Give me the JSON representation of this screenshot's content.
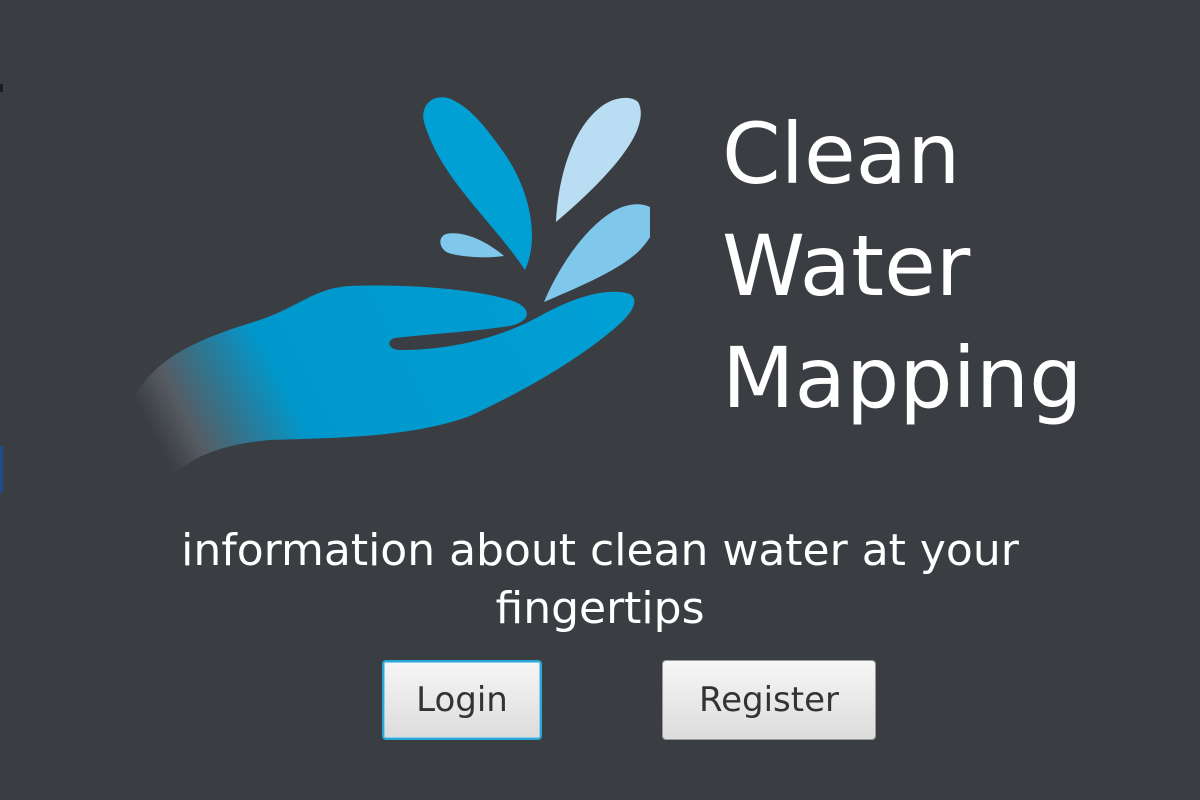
{
  "app": {
    "title_lines": [
      "Clean",
      "Water",
      "Mapping"
    ],
    "tagline": "information about clean water at your fingertips"
  },
  "actions": {
    "login_label": "Login",
    "register_label": "Register"
  },
  "logo": {
    "icon": "hand-with-water-droplets-icon",
    "colors": {
      "primary": "#009fd4",
      "light": "#7fc8ec",
      "pale": "#b9def3"
    }
  },
  "theme": {
    "background": "#3a3d41",
    "text": "#ffffff",
    "focus_ring": "#2aa7d6"
  }
}
